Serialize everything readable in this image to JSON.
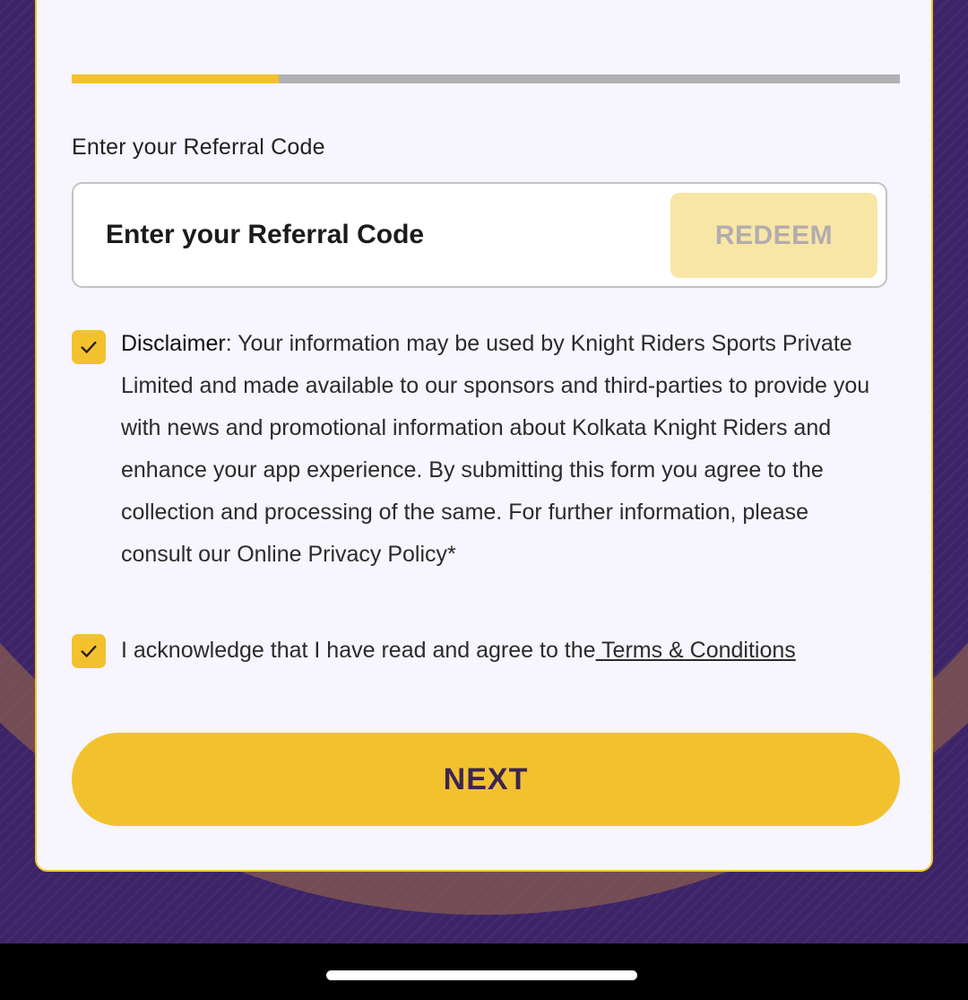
{
  "form": {
    "progress_fraction": 0.25,
    "referral_label": "Enter your Referral Code",
    "referral_placeholder": "Enter your Referral Code",
    "redeem_label": "REDEEM",
    "disclaimer_title": "Disclaimer",
    "disclaimer_text": ": Your information may be used by Knight Riders Sports Private Limited and made available to our sponsors and third-parties to provide you with news and promotional information about Kolkata Knight Riders and enhance your app experience. By submitting this form you agree to the collection and processing of the same. For further information, please consult our Online Privacy Policy*",
    "disclaimer_checked": true,
    "ack_text": "I acknowledge that I have read and agree to the",
    "terms_link": " Terms & Conditions",
    "ack_checked": true,
    "next_label": "NEXT"
  },
  "colors": {
    "accent": "#f2c22e",
    "background": "#3d2468",
    "card": "#f7f5fd"
  }
}
